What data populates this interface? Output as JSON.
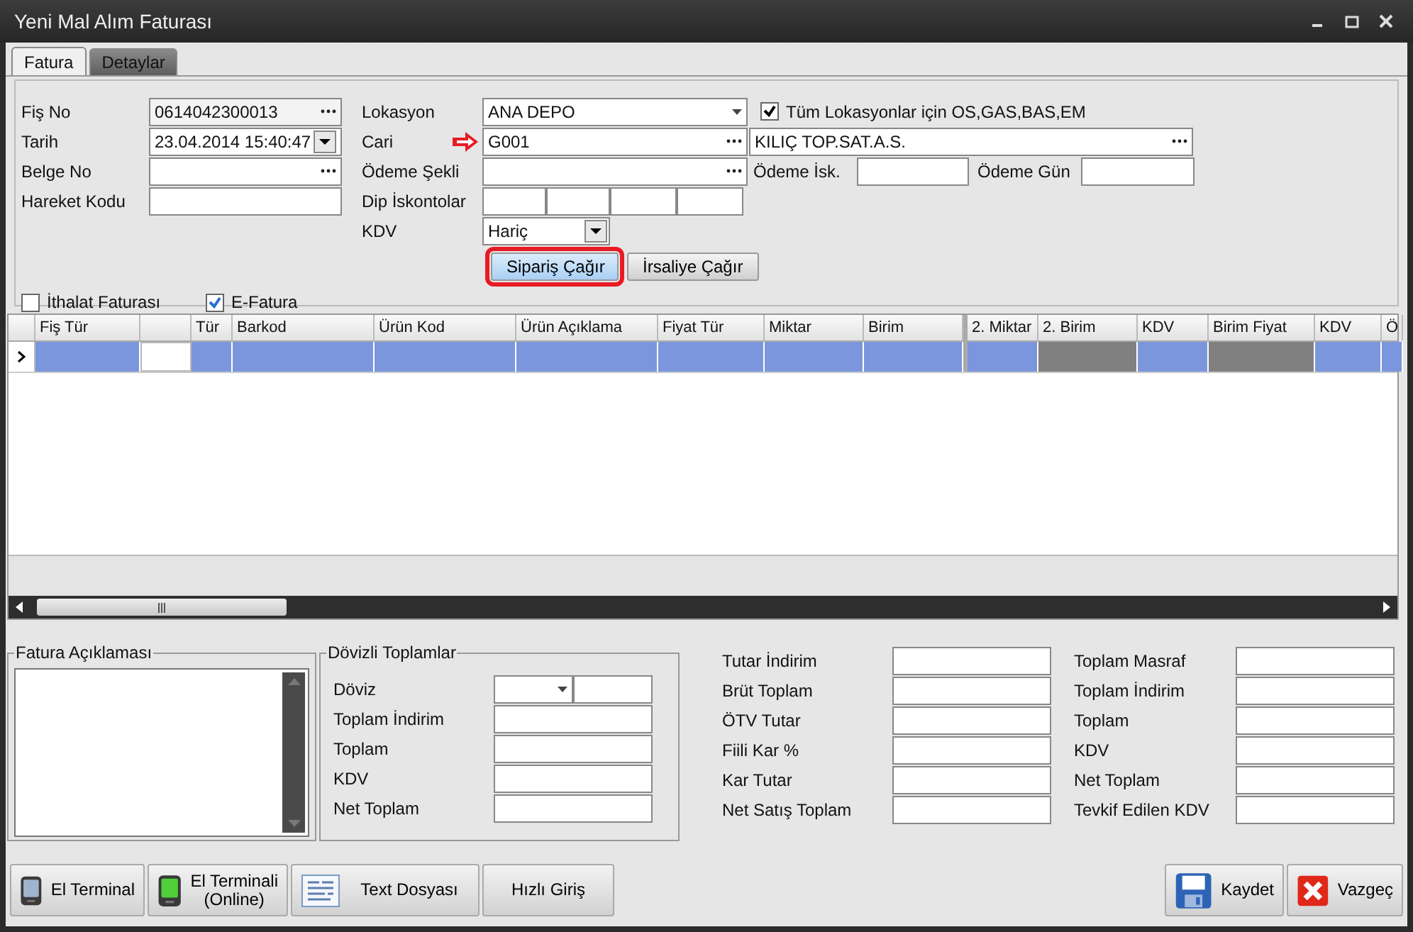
{
  "window": {
    "title": "Yeni Mal Alım Faturası"
  },
  "tabs": [
    {
      "label": "Fatura",
      "selected": true
    },
    {
      "label": "Detaylar",
      "selected": false
    }
  ],
  "form": {
    "fis_no": {
      "label": "Fiş No",
      "value": "0614042300013"
    },
    "tarih": {
      "label": "Tarih",
      "value": "23.04.2014 15:40:47"
    },
    "belge_no": {
      "label": "Belge No"
    },
    "hareket_kodu": {
      "label": "Hareket Kodu"
    },
    "lokasyon": {
      "label": "Lokasyon",
      "value": "ANA DEPO"
    },
    "all_locations": {
      "label": "Tüm Lokasyonlar için OS,GAS,BAS,EM",
      "checked": true
    },
    "cari": {
      "label": "Cari",
      "code": "G001",
      "name": "KILIÇ TOP.SAT.A.S.",
      "pointed": true
    },
    "odeme_sekli": {
      "label": "Ödeme Şekli"
    },
    "odeme_isk": {
      "label": "Ödeme İsk."
    },
    "odeme_gun": {
      "label": "Ödeme Gün"
    },
    "dip_iskontolar": {
      "label": "Dip İskontolar"
    },
    "kdv": {
      "label": "KDV",
      "value": "Hariç"
    }
  },
  "actions": [
    {
      "label": "Sipariş Çağır",
      "highlighted": true
    },
    {
      "label": "İrsaliye Çağır",
      "highlighted": false
    }
  ],
  "options": [
    {
      "label": "İthalat Faturası",
      "checked": false
    },
    {
      "label": "E-Fatura",
      "checked": true
    }
  ],
  "grid": {
    "columns": [
      {
        "label": "Fiş Tür",
        "kind": "blue"
      },
      {
        "kind": "white"
      },
      {
        "label": "Tür",
        "kind": "blue"
      },
      {
        "label": "Barkod",
        "kind": "blue"
      },
      {
        "label": "Ürün Kod",
        "kind": "blue"
      },
      {
        "label": "Ürün Açıklama",
        "kind": "blue"
      },
      {
        "label": "Fiyat Tür",
        "kind": "blue"
      },
      {
        "label": "Miktar",
        "kind": "blue"
      },
      {
        "label": "Birim",
        "kind": "blue"
      },
      {
        "label": "2. Miktar",
        "kind": "blue"
      },
      {
        "label": "2. Birim",
        "kind": "grey"
      },
      {
        "label": "KDV",
        "kind": "blue"
      },
      {
        "label": "Birim Fiyat",
        "kind": "grey"
      },
      {
        "label": "KDV",
        "kind": "blue"
      },
      {
        "label": "Ö",
        "kind": "blue"
      }
    ],
    "rows": [
      {
        "selected": true
      }
    ]
  },
  "fatura_aciklamasi": {
    "title": "Fatura Açıklaması"
  },
  "dovizli_toplamlar": {
    "title": "Dövizli Toplamlar",
    "fields": [
      {
        "label": "Döviz",
        "kind": "currency"
      },
      {
        "label": "Toplam İndirim",
        "kind": "text"
      },
      {
        "label": "Toplam",
        "kind": "text"
      },
      {
        "label": "KDV",
        "kind": "text"
      },
      {
        "label": "Net Toplam",
        "kind": "text"
      }
    ]
  },
  "totals_left": [
    "Tutar İndirim",
    "Brüt Toplam",
    "ÖTV Tutar",
    "Fiili Kar %",
    "Kar Tutar",
    "Net Satış Toplam"
  ],
  "totals_right": [
    "Toplam Masraf",
    "Toplam İndirim",
    "Toplam",
    "KDV",
    "Net Toplam",
    "Tevkif Edilen KDV"
  ],
  "toolbar_left": [
    {
      "lines": [
        "El Terminal"
      ],
      "kind": "device"
    },
    {
      "lines": [
        "El Terminali",
        "(Online)"
      ],
      "kind": "device_online"
    },
    {
      "lines": [
        "Text Dosyası"
      ],
      "kind": "text_file"
    },
    {
      "lines": [
        "Hızlı Giriş"
      ],
      "kind": "none"
    }
  ],
  "toolbar_right": [
    {
      "lines": [
        "Kaydet"
      ],
      "kind": "save"
    },
    {
      "lines": [
        "Vazgeç"
      ],
      "kind": "cancel"
    }
  ]
}
